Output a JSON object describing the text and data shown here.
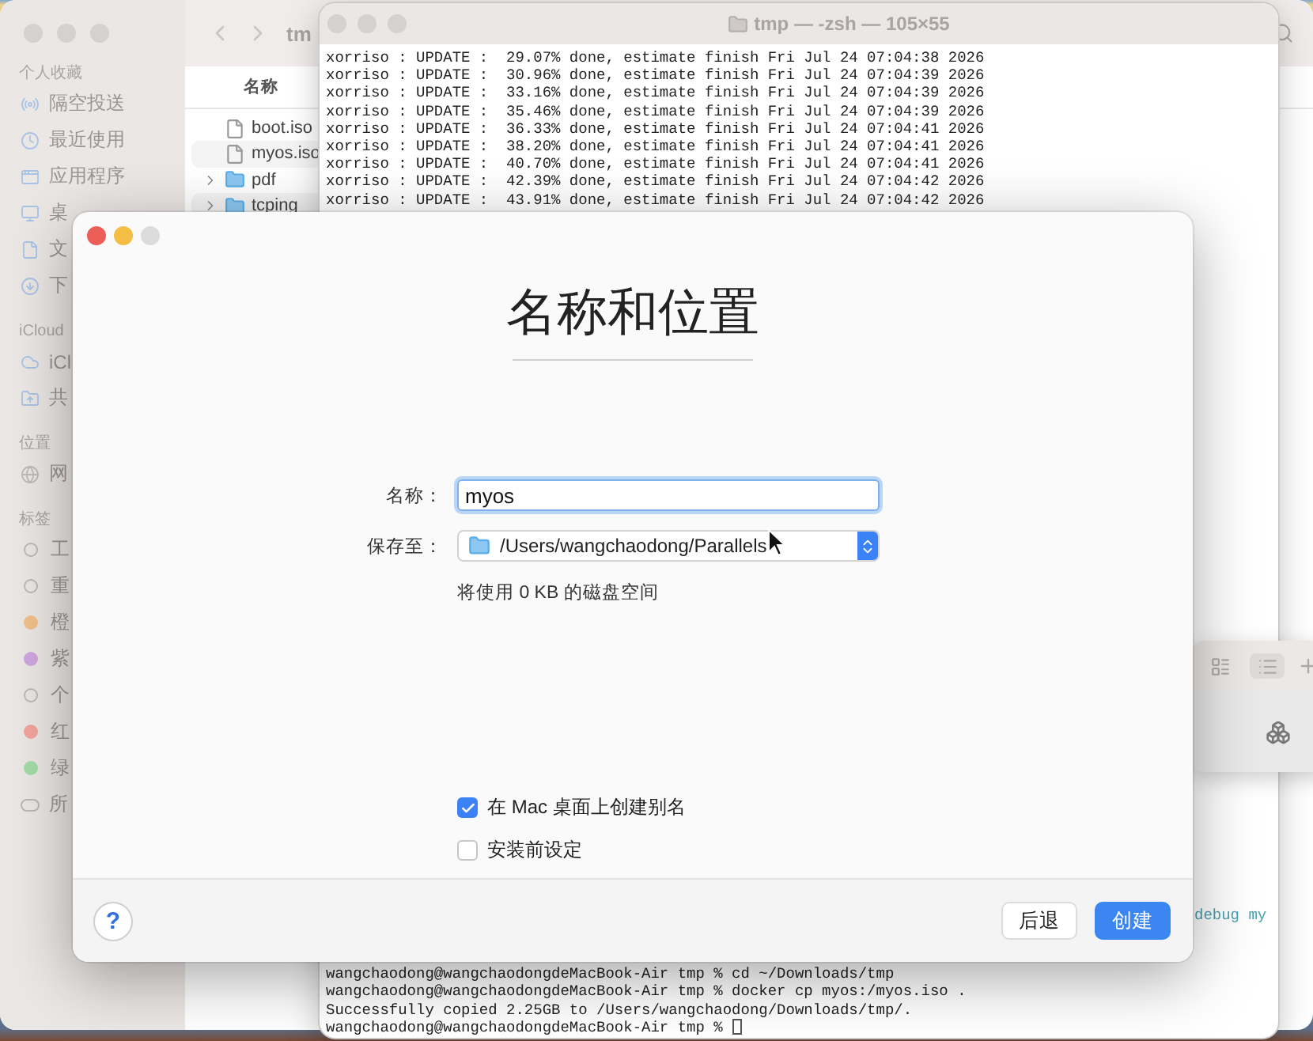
{
  "finder": {
    "title": "tm",
    "column_header": "名称",
    "sidebar": [
      {
        "heading": "个人收藏",
        "items": [
          {
            "label": "隔空投送",
            "kind": "airdrop"
          },
          {
            "label": "最近使用",
            "kind": "recent"
          },
          {
            "label": "应用程序",
            "kind": "apps"
          },
          {
            "label": "桌",
            "kind": "desktop"
          },
          {
            "label": "文",
            "kind": "document"
          },
          {
            "label": "下",
            "kind": "download"
          }
        ]
      },
      {
        "heading": "iCloud",
        "items": [
          {
            "label": "iCl",
            "kind": "cloud"
          },
          {
            "label": "共",
            "kind": "shared"
          }
        ]
      },
      {
        "heading": "位置",
        "items": [
          {
            "label": "网",
            "kind": "network"
          }
        ]
      },
      {
        "heading": "标签",
        "items": [
          {
            "label": "工",
            "kind": "tag"
          },
          {
            "label": "重",
            "kind": "tag"
          },
          {
            "label": "橙",
            "kind": "tag",
            "color": "#f0c08a"
          },
          {
            "label": "紫",
            "kind": "tag",
            "color": "#cfa6e0"
          },
          {
            "label": "个",
            "kind": "tag"
          },
          {
            "label": "红",
            "kind": "tag",
            "color": "#f2a49d"
          },
          {
            "label": "绿",
            "kind": "tag",
            "color": "#a3dba7"
          },
          {
            "label": "所",
            "kind": "all-tags"
          }
        ]
      }
    ],
    "files": [
      {
        "name": "boot.iso",
        "kind": "file"
      },
      {
        "name": "myos.iso",
        "kind": "file"
      },
      {
        "name": "pdf",
        "kind": "folder"
      },
      {
        "name": "tcping",
        "kind": "folder"
      }
    ]
  },
  "terminal": {
    "title": "tmp — -zsh — 105×55",
    "top_lines": [
      "xorriso : UPDATE :  29.07% done, estimate finish Fri Jul 24 07:04:38 2026",
      "xorriso : UPDATE :  30.96% done, estimate finish Fri Jul 24 07:04:39 2026",
      "xorriso : UPDATE :  33.16% done, estimate finish Fri Jul 24 07:04:39 2026",
      "xorriso : UPDATE :  35.46% done, estimate finish Fri Jul 24 07:04:39 2026",
      "xorriso : UPDATE :  36.33% done, estimate finish Fri Jul 24 07:04:41 2026",
      "xorriso : UPDATE :  38.20% done, estimate finish Fri Jul 24 07:04:41 2026",
      "xorriso : UPDATE :  40.70% done, estimate finish Fri Jul 24 07:04:41 2026",
      "xorriso : UPDATE :  42.39% done, estimate finish Fri Jul 24 07:04:42 2026",
      "xorriso : UPDATE :  43.91% done, estimate finish Fri Jul 24 07:04:42 2026"
    ],
    "middle_fragment": "debug my",
    "bottom_lines": [
      "wangchaodong@wangchaodongdeMacBook-Air tmp % cd ~/Downloads/tmp",
      "wangchaodong@wangchaodongdeMacBook-Air tmp % docker cp myos:/myos.iso .",
      "Successfully copied 2.25GB to /Users/wangchaodong/Downloads/tmp/.",
      "wangchaodong@wangchaodongdeMacBook-Air tmp % "
    ]
  },
  "dialog": {
    "title": "名称和位置",
    "name_label": "名称：",
    "name_value": "myos",
    "save_label": "保存至：",
    "save_path": "/Users/wangchaodong/Parallels",
    "disk_note": "将使用 0 KB 的磁盘空间",
    "checkboxes": [
      {
        "label": "在 Mac 桌面上创建别名",
        "checked": true
      },
      {
        "label": "安装前设定",
        "checked": false
      }
    ],
    "help": "?",
    "buttons": [
      {
        "label": "后退",
        "kind": "secondary"
      },
      {
        "label": "创建",
        "kind": "primary"
      }
    ]
  }
}
